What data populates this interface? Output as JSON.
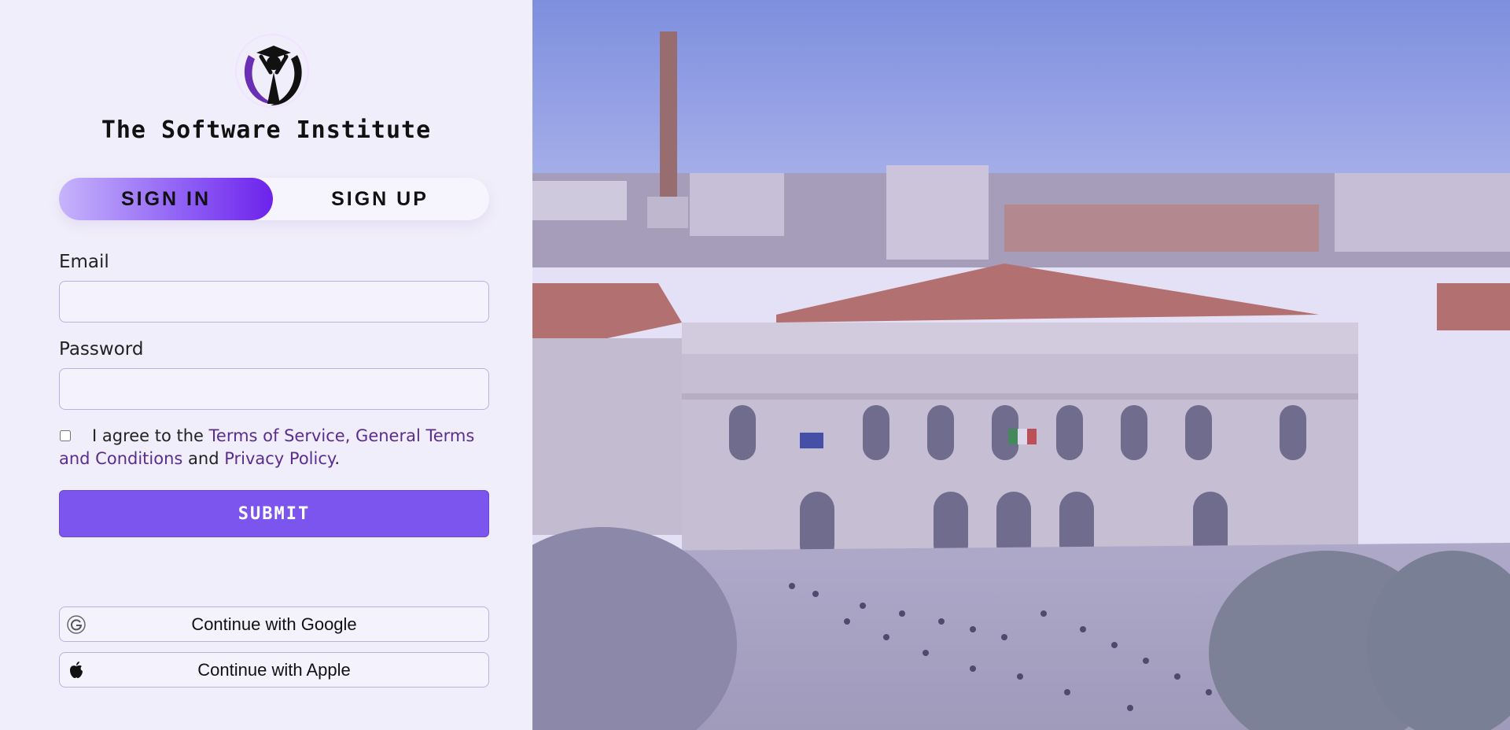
{
  "brand": {
    "title": "The Software Institute",
    "logo_icon": "graduate-logo-icon"
  },
  "tabs": {
    "signin_label": "SIGN IN",
    "signup_label": "SIGN UP",
    "active": "signin"
  },
  "form": {
    "email_label": "Email",
    "email_value": "",
    "password_label": "Password",
    "password_value": "",
    "agree": {
      "checked": false,
      "prefix": "I agree to the ",
      "terms_link": "Terms of Service, General Terms and Conditions",
      "middle": " and ",
      "privacy_link": "Privacy Policy",
      "suffix": "."
    },
    "submit_label": "SUBMIT"
  },
  "social": {
    "google_label": "Continue with Google",
    "google_icon": "google-icon",
    "apple_label": "Continue with Apple",
    "apple_icon": "apple-icon"
  },
  "hero": {
    "image_icon": "campus-building-photo"
  },
  "colors": {
    "accent": "#7b55ee",
    "accent_dark": "#6d22eb",
    "link": "#5a2d8e",
    "panel_bg": "#f1eefb",
    "field_border": "#b9b0e4"
  }
}
